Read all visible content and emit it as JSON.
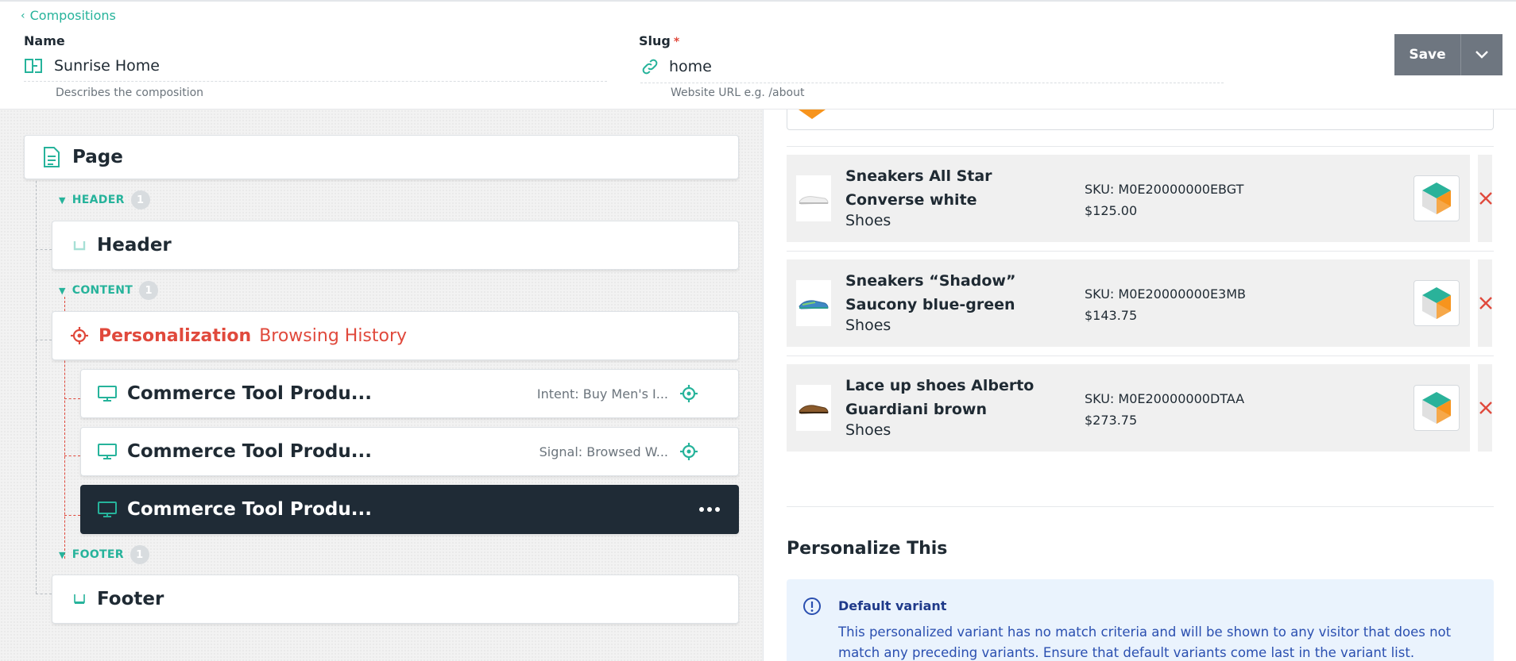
{
  "header": {
    "back_label": "Compositions",
    "name_label": "Name",
    "name_value": "Sunrise Home",
    "name_hint": "Describes the composition",
    "slug_label": "Slug",
    "slug_required": "*",
    "slug_value": "home",
    "slug_hint": "Website URL e.g. /about",
    "save_label": "Save"
  },
  "tree": {
    "root": "Page",
    "sections": [
      {
        "label": "HEADER",
        "count": "1"
      },
      {
        "label": "CONTENT",
        "count": "1"
      },
      {
        "label": "FOOTER",
        "count": "1"
      }
    ],
    "header_item": "Header",
    "personalization": {
      "label": "Personalization",
      "sub": "Browsing History"
    },
    "variants": [
      {
        "title": "Commerce Tool Produ...",
        "meta": "Intent: Buy Men's I..."
      },
      {
        "title": "Commerce Tool Produ...",
        "meta": "Signal: Browsed W..."
      },
      {
        "title": "Commerce Tool Produ...",
        "meta": ""
      }
    ],
    "footer_item": "Footer"
  },
  "products": [
    {
      "name": "Sneakers All Star Converse white",
      "category": "Shoes",
      "sku": "SKU: M0E20000000EBGT",
      "price": "$125.00"
    },
    {
      "name": "Sneakers “Shadow” Saucony blue-green",
      "category": "Shoes",
      "sku": "SKU: M0E20000000E3MB",
      "price": "$143.75"
    },
    {
      "name": "Lace up shoes Alberto Guardiani brown",
      "category": "Shoes",
      "sku": "SKU: M0E20000000DTAA",
      "price": "$273.75"
    }
  ],
  "personalize": {
    "title": "Personalize This",
    "info_title": "Default variant",
    "info_body": "This personalized variant has no match criteria and will be shown to any visitor that does not match any preceding variants. Ensure that default variants come last in the variant list. Personalize this"
  },
  "colors": {
    "accent": "#26b39b",
    "danger": "#e0493c",
    "dark": "#1f2b36",
    "save": "#6e7680",
    "info_bg": "#eaf3fd"
  }
}
